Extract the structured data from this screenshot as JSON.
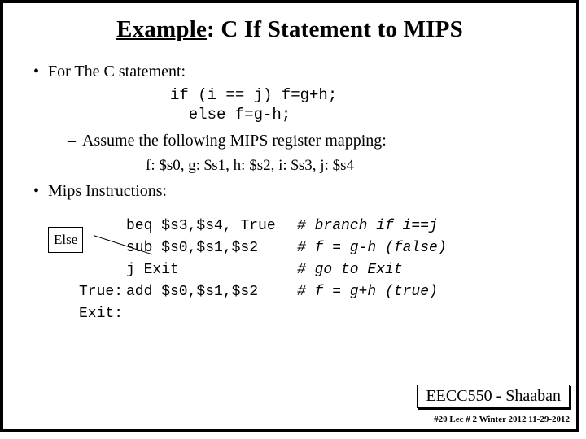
{
  "title": {
    "underlined": "Example",
    "rest": ": C If Statement to MIPS"
  },
  "c_statement_label": "For The C statement:",
  "c_code": {
    "line1": "if (i == j) f=g+h;",
    "line2": "  else f=g-h;"
  },
  "assume_label": "Assume the following MIPS register mapping:",
  "mapping": "f: $s0,  g: $s1,  h: $s2, i:  $s3,  j: $s4",
  "mips_label": "Mips Instructions:",
  "else_box": "Else",
  "mips": [
    {
      "label": "",
      "instr": "beq $s3,$s4, True",
      "comment": "# branch if i==j"
    },
    {
      "label": "",
      "instr": "sub $s0,$s1,$s2",
      "comment": "# f = g-h (false)"
    },
    {
      "label": "",
      "instr": "j Exit",
      "comment": "# go to Exit"
    },
    {
      "label": "True:",
      "instr": "add $s0,$s1,$s2",
      "comment": "# f = g+h (true)"
    },
    {
      "label": "Exit:",
      "instr": "",
      "comment": ""
    }
  ],
  "footer": {
    "course": "EECC550 - Shaaban",
    "meta": "#20  Lec # 2  Winter 2012  11-29-2012"
  }
}
